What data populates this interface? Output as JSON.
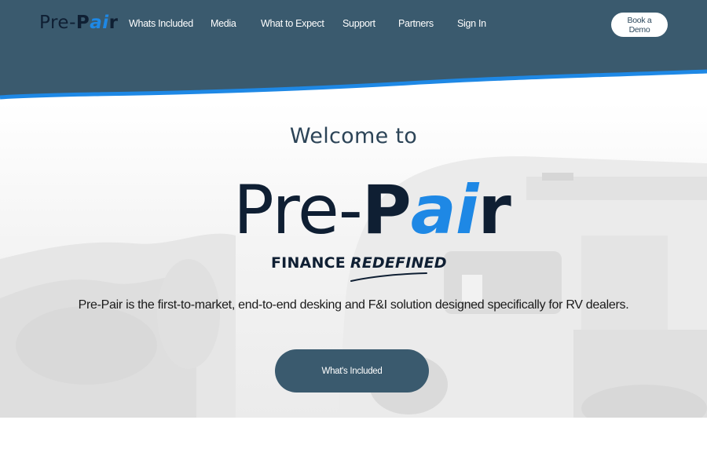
{
  "brand": {
    "logo_pre": "Pre-",
    "logo_p": "P",
    "logo_ai": "ai",
    "logo_r": "r"
  },
  "nav": {
    "items": [
      {
        "label": "Whats Included"
      },
      {
        "label": "Media"
      },
      {
        "label": "What to Expect"
      },
      {
        "label": "Support"
      },
      {
        "label": "Partners"
      },
      {
        "label": "Sign In"
      }
    ],
    "book_demo_label": "Book a Demo"
  },
  "hero": {
    "welcome": "Welcome to",
    "tagline_finance": "FINANCE",
    "tagline_redefined": "REDEFINED",
    "description": "Pre-Pair is the first-to-market, end-to-end desking and F&I solution designed specifically for RV dealers.",
    "cta_label": "What's Included"
  },
  "colors": {
    "header_bg": "#3a5a6e",
    "accent_blue": "#1e88e5",
    "navy": "#0f1f33",
    "button_bg": "#3a5a6e"
  }
}
